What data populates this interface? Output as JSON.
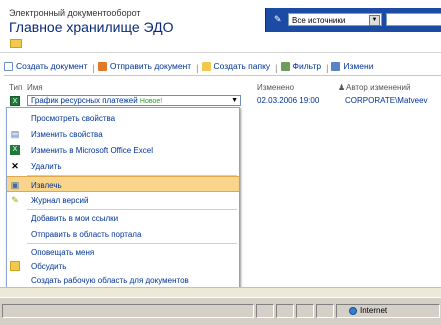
{
  "header": {
    "site_subtitle": "Электронный документооборот",
    "site_title": "Главное хранилище ЭДО",
    "search_scope": "Все источники"
  },
  "toolbar": {
    "items": [
      {
        "label": "Создать документ",
        "icon": "new-document-icon"
      },
      {
        "label": "Отправить документ",
        "icon": "upload-icon"
      },
      {
        "label": "Создать папку",
        "icon": "new-folder-icon"
      },
      {
        "label": "Фильтр",
        "icon": "filter-icon"
      },
      {
        "label": "Измени",
        "icon": "edit-icon"
      }
    ]
  },
  "columns": {
    "type": "Тип",
    "name": "Имя",
    "modified": "Изменено",
    "author": "Автор изменений"
  },
  "row": {
    "name": "График ресурсных платежей",
    "badge": "Новое!",
    "modified": "02.03.2006 19:00",
    "author": "CORPORATE\\Matveev"
  },
  "menu": {
    "items": [
      {
        "label": "Просмотреть свойства",
        "icon": ""
      },
      {
        "label": "Изменить свойства",
        "icon": "edit-properties-icon"
      },
      {
        "label": "Изменить в Microsoft Office Excel",
        "icon": "excel-icon"
      },
      {
        "label": "Удалить",
        "icon": "delete-icon"
      },
      {
        "label": "Извлечь",
        "icon": "checkout-icon"
      },
      {
        "label": "Журнал версий",
        "icon": "version-history-icon"
      },
      {
        "label": "Добавить в мои ссылки",
        "icon": ""
      },
      {
        "label": "Отправить в область портала",
        "icon": ""
      },
      {
        "label": "Оповещать меня",
        "icon": ""
      },
      {
        "label": "Обсудить",
        "icon": "discuss-icon"
      },
      {
        "label": "Создать рабочую область для документов",
        "icon": ""
      }
    ],
    "highlighted_index": 4
  },
  "status": {
    "zone": "Internet"
  },
  "colors": {
    "accent": "#1c4ba6",
    "highlight": "#f8d58a",
    "link": "#003399"
  }
}
